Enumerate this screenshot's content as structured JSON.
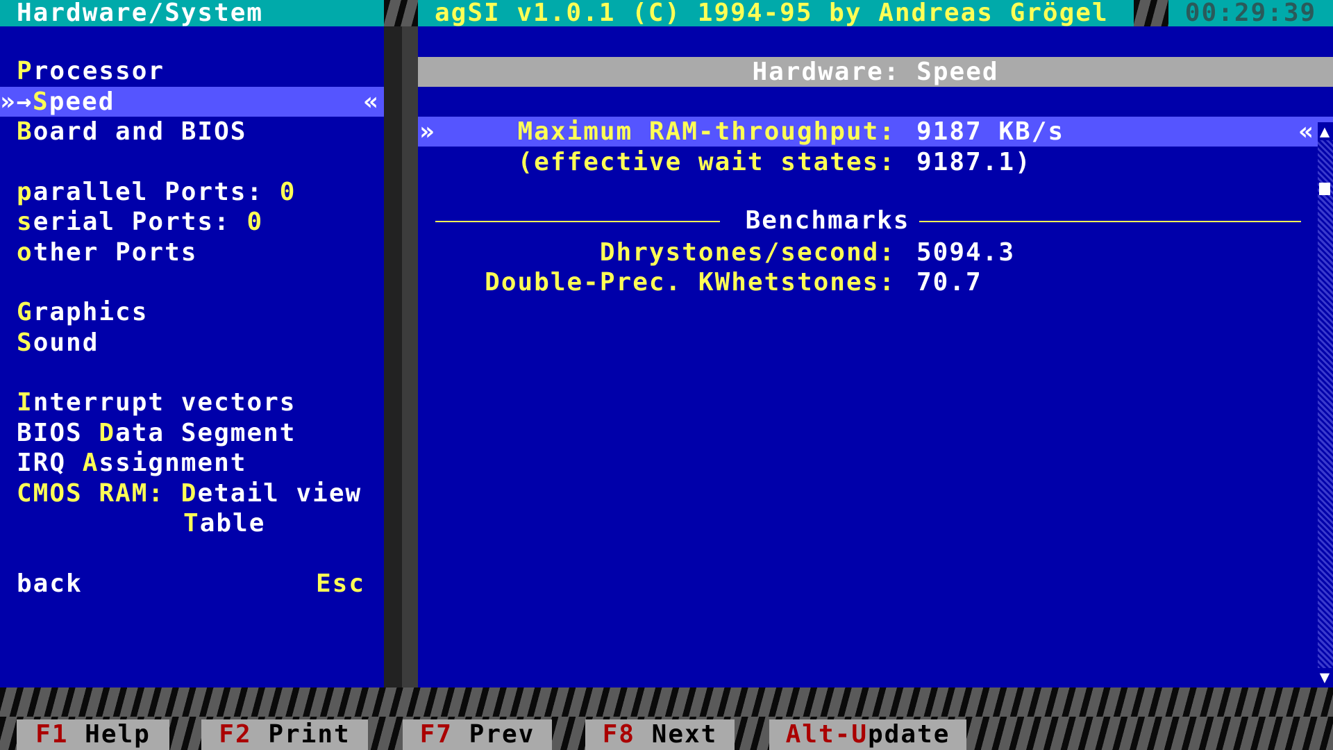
{
  "left_title": "Hardware/System",
  "app_title": "agSI v1.0.1 (C) 1994-95 by Andreas Grögel",
  "clock": "00:29:39",
  "menu": {
    "processor": {
      "hot": "P",
      "rest": "rocessor"
    },
    "speed": {
      "prefix": "»→",
      "hot": "S",
      "rest": "peed",
      "suffix": "«"
    },
    "board": {
      "hot": "B",
      "rest": "oard and BIOS"
    },
    "parallel": {
      "hot": "p",
      "rest": "arallel Ports: ",
      "count": "0"
    },
    "serial": {
      "hot": "s",
      "rest": "erial Ports: ",
      "count": "0"
    },
    "other": {
      "hot": "o",
      "rest": "ther Ports"
    },
    "graphics": {
      "hot": "G",
      "rest": "raphics"
    },
    "sound": {
      "hot": "S",
      "rest": "ound"
    },
    "interrupt": {
      "hot": "I",
      "rest": "nterrupt vectors"
    },
    "bios_data": {
      "pre": "BIOS ",
      "hot": "D",
      "rest": "ata Segment"
    },
    "irq": {
      "pre": "IRQ ",
      "hot": "A",
      "rest": "ssignment"
    },
    "cmos": {
      "label": "CMOS RAM: ",
      "hot": "D",
      "rest": "etail view"
    },
    "table": {
      "hot": "T",
      "rest": "able"
    },
    "back": {
      "label": "back",
      "key": "Esc"
    }
  },
  "panel": {
    "header": "Hardware: Speed",
    "sel_left": "»",
    "sel_right": "«",
    "ram_label": "Maximum RAM-throughput:",
    "ram_value": "9187 KB/s",
    "wait_label": "(effective wait states:",
    "wait_value": "9187.1)",
    "bench_title": "Benchmarks",
    "dhry_label": "Dhrystones/second:",
    "dhry_value": "5094.3",
    "whet_label": "Double-Prec. KWhetstones:",
    "whet_value": "70.7",
    "scroll_up": "▲",
    "scroll_down": "▼"
  },
  "fkeys": [
    {
      "key": "F1",
      "label": " Help"
    },
    {
      "key": "F2",
      "label": " Print"
    },
    {
      "key": "F7",
      "label": " Prev"
    },
    {
      "key": "F8",
      "label": " Next"
    },
    {
      "key": "Alt-U",
      "label": "pdate"
    }
  ]
}
